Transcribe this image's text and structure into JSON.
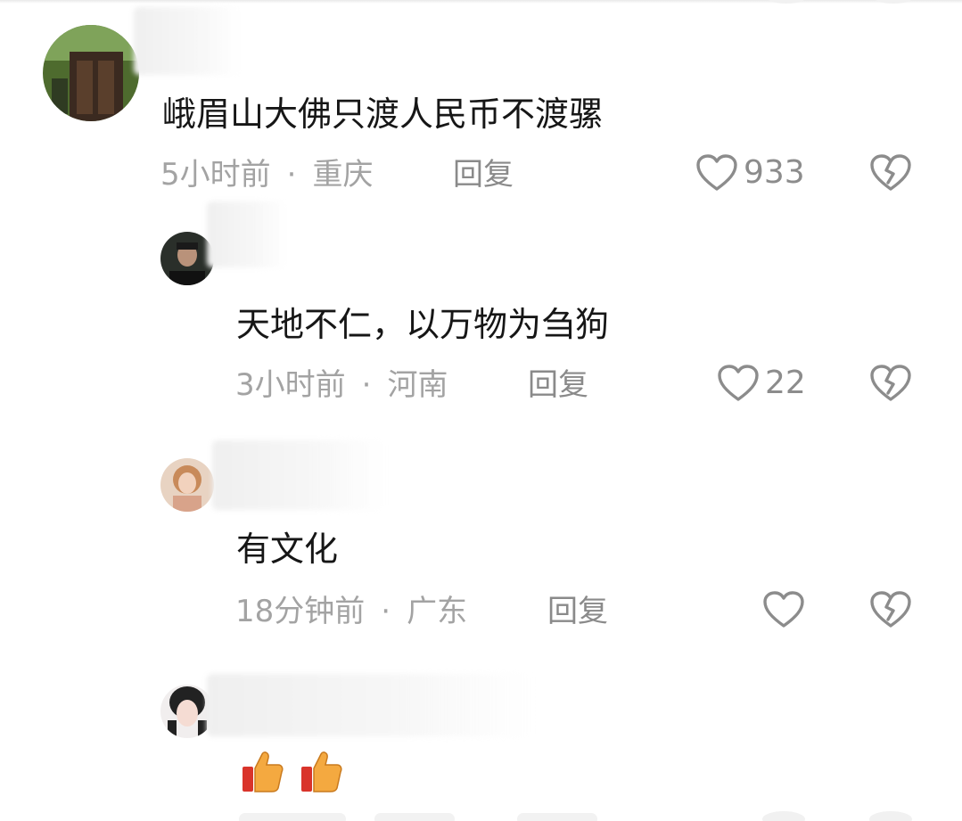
{
  "colors": {
    "text": "#161616",
    "meta": "#a3a3a3",
    "icon": "#8c8c8c",
    "emoji_thumb": "#f4a940",
    "emoji_cuff": "#d9342b"
  },
  "comments": [
    {
      "text": "峨眉山大佛只渡人民币不渡骡",
      "time": "5小时前",
      "location": "重庆",
      "reply_label": "回复",
      "likes": "933",
      "like_icon": "heart-outline-icon",
      "dislike_icon": "broken-heart-icon"
    },
    {
      "text": "天地不仁，以万物为刍狗",
      "time": "3小时前",
      "location": "河南",
      "reply_label": "回复",
      "likes": "22",
      "like_icon": "heart-outline-icon",
      "dislike_icon": "broken-heart-icon"
    },
    {
      "text": "有文化",
      "time": "18分钟前",
      "location": "广东",
      "reply_label": "回复",
      "likes": "",
      "like_icon": "heart-outline-icon",
      "dislike_icon": "broken-heart-icon"
    },
    {
      "emojis": [
        "thumbs-up-icon",
        "thumbs-up-icon"
      ]
    }
  ],
  "separator": "·"
}
